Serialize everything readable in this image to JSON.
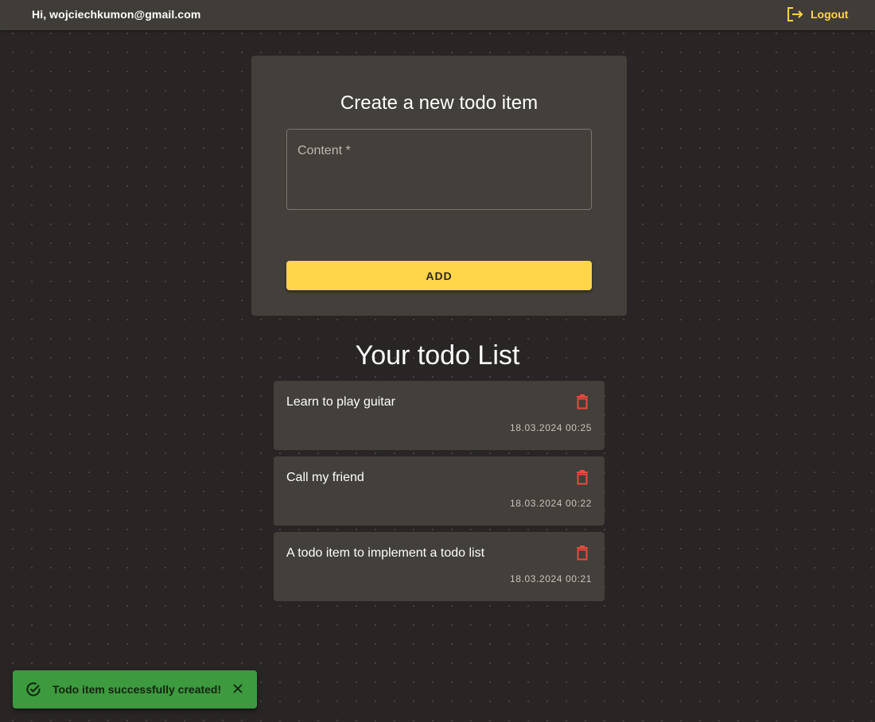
{
  "header": {
    "greeting": "Hi, wojciechkumon@gmail.com",
    "logout_label": "Logout",
    "logout_icon": "logout-icon"
  },
  "create": {
    "title": "Create a new todo item",
    "content_label": "Content *",
    "content_value": "",
    "add_label": "ADD"
  },
  "list": {
    "title": "Your todo List",
    "items": [
      {
        "text": "Learn to play guitar",
        "date": "18.03.2024 00:25"
      },
      {
        "text": "Call my friend",
        "date": "18.03.2024 00:22"
      },
      {
        "text": "A todo item to implement a todo list",
        "date": "18.03.2024 00:21"
      }
    ]
  },
  "snackbar": {
    "message": "Todo item successfully created!",
    "icon": "check-circle-icon",
    "close_icon": "close-icon"
  },
  "colors": {
    "accent": "#ffd54a",
    "delete": "#e84b3c",
    "success": "#3d9a3f",
    "background": "#282524",
    "card": "#433f3a"
  }
}
